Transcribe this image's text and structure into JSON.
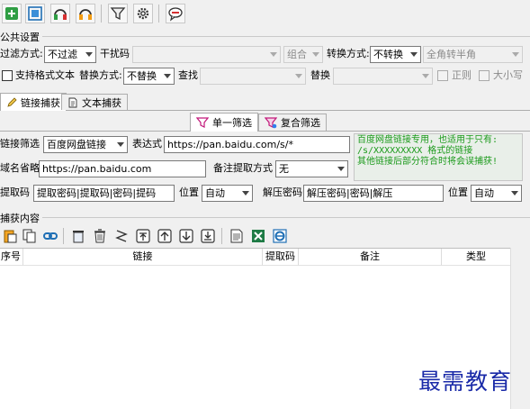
{
  "toolbar": {
    "buttons": [
      {
        "name": "add-icon"
      },
      {
        "name": "capture-icon"
      },
      {
        "name": "headset-green-icon"
      },
      {
        "name": "headset-orange-icon"
      },
      {
        "name": "filter-icon"
      },
      {
        "name": "gear-icon"
      },
      {
        "name": "comment-icon"
      }
    ]
  },
  "common": {
    "title": "公共设置",
    "filter_mode_label": "过滤方式:",
    "filter_mode_value": "不过滤",
    "interference_label": "干扰码",
    "interference_value": "",
    "combine_value": "组合",
    "convert_mode_label": "转换方式:",
    "convert_mode_value": "不转换",
    "width_value": "全角转半角",
    "rich_text_label": "支持格式文本",
    "replace_mode_label": "替换方式:",
    "replace_mode_value": "不替换",
    "find_label": "查找",
    "find_value": "",
    "replace_label": "替换",
    "replace_value": "",
    "regex_label": "正则",
    "case_label": "大小写"
  },
  "tabs": {
    "link_capture": "链接捕获",
    "text_capture": "文本捕获"
  },
  "subtabs": {
    "single": "单一筛选",
    "composite": "复合筛选"
  },
  "filter": {
    "link_filter_label": "链接筛选",
    "link_filter_value": "百度网盘链接",
    "expression_label": "表达式",
    "expression_value": "https://pan.baidu.com/s/*",
    "domain_label": "域名省略",
    "domain_value": "https://pan.baidu.com",
    "remark_mode_label": "备注提取方式",
    "remark_mode_value": "无",
    "extract_code_label": "提取码",
    "extract_code_value": "提取密码|提取码|密码|提码",
    "position_label": "位置",
    "position_value": "自动",
    "unzip_label": "解压密码",
    "unzip_value": "解压密码|密码|解压",
    "position2_label": "位置",
    "position2_value": "自动",
    "note_text": "百度网盘链接专用，也适用于只有:\n/s/XXXXXXXXX 格式的链接\n其他链接后部分符合时将会误捕获!"
  },
  "capture": {
    "title": "捕获内容",
    "buttons": [
      {
        "name": "paste-icon"
      },
      {
        "name": "copy-icon"
      },
      {
        "name": "link-icon"
      },
      {
        "name": "clear-icon"
      },
      {
        "name": "trash-icon"
      },
      {
        "name": "dedupe-icon"
      },
      {
        "name": "move-top-icon"
      },
      {
        "name": "move-up-icon"
      },
      {
        "name": "move-down-icon"
      },
      {
        "name": "move-bottom-icon"
      },
      {
        "name": "export-text-icon"
      },
      {
        "name": "export-excel-icon"
      },
      {
        "name": "export-ie-icon"
      }
    ],
    "columns": [
      "序号",
      "链接",
      "提取码",
      "备注",
      "类型"
    ]
  },
  "watermark": "最需教育"
}
